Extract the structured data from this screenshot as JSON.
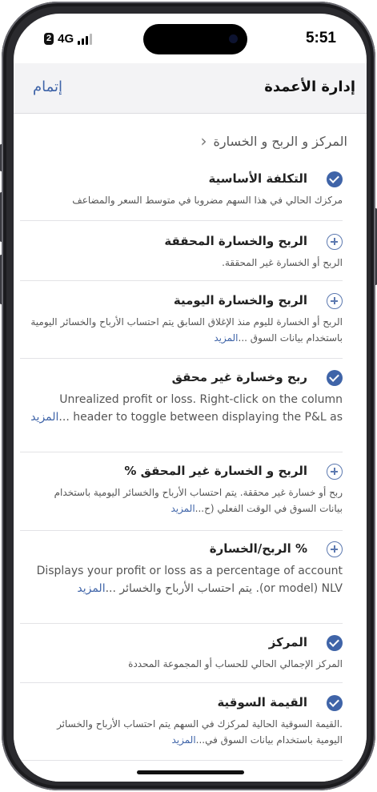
{
  "status": {
    "sim": "2",
    "network": "4G",
    "time": "5:51"
  },
  "nav": {
    "title": "إدارة الأعمدة",
    "done": "إتمام"
  },
  "section": {
    "label": "المركز و الربح و الخسارة"
  },
  "rows": [
    {
      "title": "التكلفة الأساسية",
      "desc": "مركزك الحالي في هذا السهم مضروبا في متوسط السعر والمضاعف",
      "more": "",
      "selected": true
    },
    {
      "title": "الربح والخسارة المحققة",
      "desc": "الربح أو الخسارة غير المحققة.",
      "more": "",
      "selected": false
    },
    {
      "title": "الربح والخسارة اليومية",
      "desc": "الربح أو الخسارة لليوم منذ الإغلاق السابق يتم احتساب الأرباح والخسائر اليومية باستخدام بيانات السوق ...",
      "more": "المزيد",
      "selected": false
    },
    {
      "title": "ربح وخسارة غير محقق",
      "desc": "Unrealized profit or loss. Right-click on the column header to toggle between displaying the P&L as ...",
      "more": "المزيد",
      "selected": true
    },
    {
      "title": "الربح و الخسارة غير المحقق %",
      "desc": "ربح أو خسارة غير محققة. يتم احتساب الأرباح والخسائر اليومية باستخدام بيانات السوق في الوقت الفعلي (ح...",
      "more": "المزيد",
      "selected": false
    },
    {
      "title": "% الربح/الخسارة",
      "desc": "Displays your profit or loss as a percentage of account (or model) NLV. يتم احتساب الأرباح والخسائر ...",
      "more": "المزيد",
      "selected": false
    },
    {
      "title": "المركز",
      "desc": "المركز الإجمالي الحالي للحساب أو المجموعة المحددة",
      "more": "",
      "selected": true
    },
    {
      "title": "القيمة السوقية",
      "desc": ".القيمة السوقية الحالية لمركزك في السهم يتم احتساب الأرباح والخسائر اليومية باستخدام بيانات السوق في...",
      "more": "المزيد",
      "selected": true
    }
  ]
}
